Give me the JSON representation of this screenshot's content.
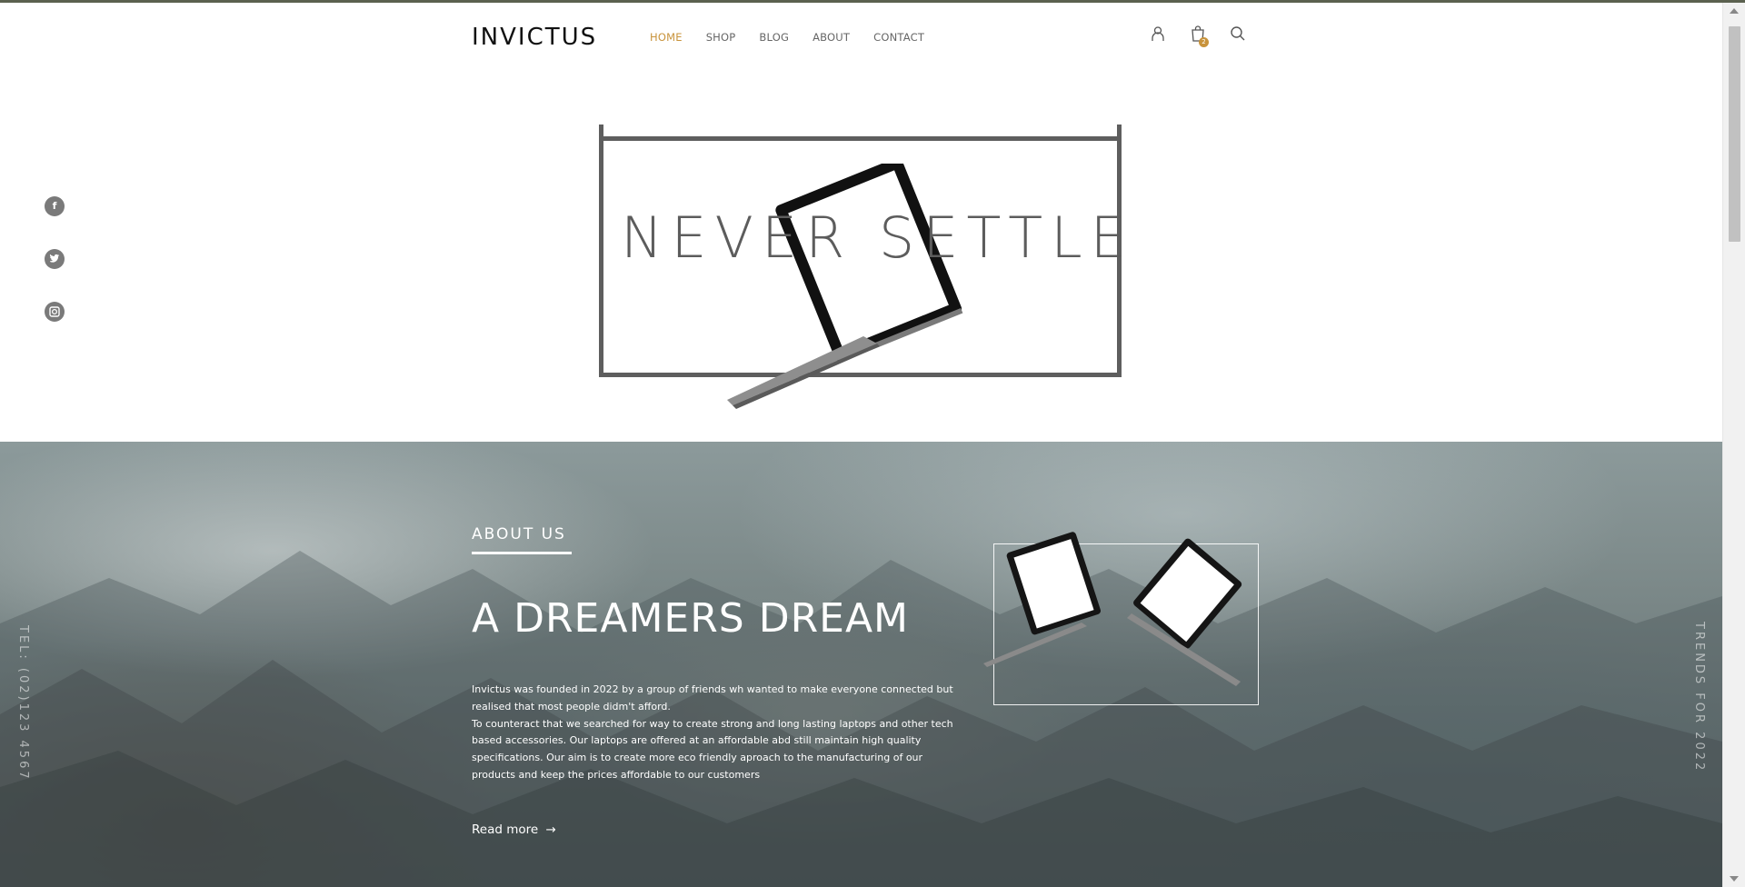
{
  "brand": {
    "logo_text": "INVICTUS",
    "accent_color": "#c8933b"
  },
  "nav": {
    "items": [
      {
        "label": "HOME",
        "active": true
      },
      {
        "label": "SHOP",
        "active": false
      },
      {
        "label": "BLOG",
        "active": false
      },
      {
        "label": "ABOUT",
        "active": false
      },
      {
        "label": "CONTACT",
        "active": false
      }
    ]
  },
  "header_icons": {
    "account": "user-icon",
    "cart": "shopping-bag-icon",
    "cart_count": "2",
    "search": "search-icon"
  },
  "social": [
    {
      "label": "f",
      "icon": "facebook-icon"
    },
    {
      "label": "t",
      "icon": "twitter-icon"
    },
    {
      "label": "◎",
      "icon": "instagram-icon"
    }
  ],
  "hero": {
    "title": "NEVER SETTLE"
  },
  "about": {
    "kicker": "ABOUT US",
    "title": "A DREAMERS DREAM",
    "paragraphs": [
      "Invictus was founded in 2022 by a group of friends wh wanted to make everyone connected but realised that most people didm't afford.",
      "To counteract that we searched for way to create strong and long lasting laptops and other tech based accessories. Our laptops are offered at an affordable abd still maintain high quality specifications. Our aim is to create more eco friendly aproach to the manufacturing of our products and keep the prices affordable to our customers"
    ],
    "read_more": "Read more",
    "side_left": "TEL: (02)123 4567",
    "side_right": "TRENDS FOR 2022"
  }
}
